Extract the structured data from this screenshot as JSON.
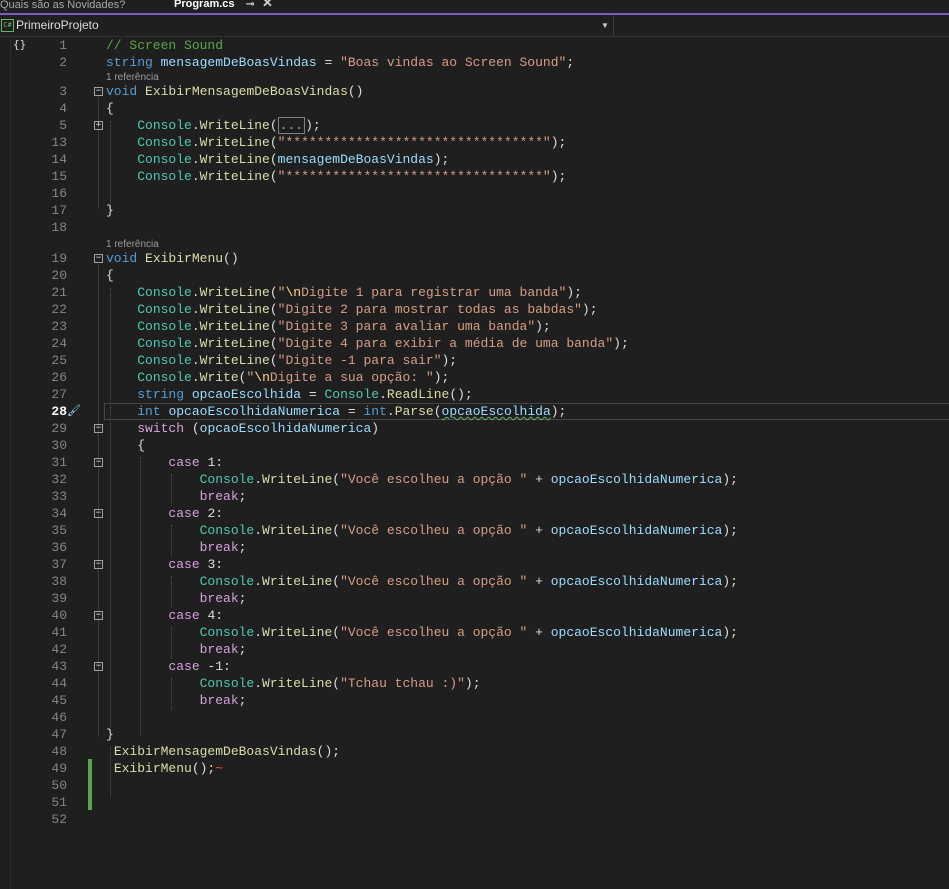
{
  "tabs": {
    "inactive": "Quais são as Novidades?",
    "active": "Program.cs",
    "pin_icon": "pin-icon",
    "close_icon": "close-icon"
  },
  "navbar": {
    "project": "PrimeiroProjeto",
    "project_icon": "csharp-project-icon",
    "dropdown_icon": "chevron-down-icon"
  },
  "editor": {
    "current_line": "28",
    "lens_text": "1 referência",
    "colors": {
      "background": "#1f1f1f",
      "accent": "#7d5bc4",
      "keyword": "#569cd6",
      "control": "#d8a0df",
      "string": "#d69d85",
      "method": "#dcdcaa",
      "class": "#4ec9b0",
      "variable": "#9cdcfe",
      "comment": "#57a64a"
    },
    "lines": [
      {
        "n": "1",
        "text": "// Screen Sound"
      },
      {
        "n": "2",
        "text": "string mensagemDeBoasVindas = \"Boas vindas ao Screen Sound\";"
      },
      {
        "n": "3",
        "text": "void ExibirMensagemDeBoasVindas()"
      },
      {
        "n": "4",
        "text": "{"
      },
      {
        "n": "5",
        "text": "    Console.WriteLine(...);"
      },
      {
        "n": "13",
        "text": "    Console.WriteLine(\"*********************************\");"
      },
      {
        "n": "14",
        "text": "    Console.WriteLine(mensagemDeBoasVindas);"
      },
      {
        "n": "15",
        "text": "    Console.WriteLine(\"*********************************\");"
      },
      {
        "n": "16",
        "text": ""
      },
      {
        "n": "17",
        "text": "}"
      },
      {
        "n": "18",
        "text": ""
      },
      {
        "n": "19",
        "text": "void ExibirMenu()"
      },
      {
        "n": "20",
        "text": "{"
      },
      {
        "n": "21",
        "text": "    Console.WriteLine(\"\\nDigite 1 para registrar uma banda\");"
      },
      {
        "n": "22",
        "text": "    Console.WriteLine(\"Digite 2 para mostrar todas as babdas\");"
      },
      {
        "n": "23",
        "text": "    Console.WriteLine(\"Digite 3 para avaliar uma banda\");"
      },
      {
        "n": "24",
        "text": "    Console.WriteLine(\"Digite 4 para exibir a média de uma banda\");"
      },
      {
        "n": "25",
        "text": "    Console.WriteLine(\"Digite -1 para sair\");"
      },
      {
        "n": "26",
        "text": "    Console.Write(\"\\nDigite a sua opção: \");"
      },
      {
        "n": "27",
        "text": "    string opcaoEscolhida = Console.ReadLine();"
      },
      {
        "n": "28",
        "text": "    int opcaoEscolhidaNumerica = int.Parse(opcaoEscolhida);"
      },
      {
        "n": "29",
        "text": "    switch (opcaoEscolhidaNumerica)"
      },
      {
        "n": "30",
        "text": "    {"
      },
      {
        "n": "31",
        "text": "        case 1:"
      },
      {
        "n": "32",
        "text": "            Console.WriteLine(\"Você escolheu a opção \" + opcaoEscolhidaNumerica);"
      },
      {
        "n": "33",
        "text": "            break;"
      },
      {
        "n": "34",
        "text": "        case 2:"
      },
      {
        "n": "35",
        "text": "            Console.WriteLine(\"Você escolheu a opção \" + opcaoEscolhidaNumerica);"
      },
      {
        "n": "36",
        "text": "            break;"
      },
      {
        "n": "37",
        "text": "        case 3:"
      },
      {
        "n": "38",
        "text": "            Console.WriteLine(\"Você escolheu a opção \" + opcaoEscolhidaNumerica);"
      },
      {
        "n": "39",
        "text": "            break;"
      },
      {
        "n": "40",
        "text": "        case 4:"
      },
      {
        "n": "41",
        "text": "            Console.WriteLine(\"Você escolheu a opção \" + opcaoEscolhidaNumerica);"
      },
      {
        "n": "42",
        "text": "            break;"
      },
      {
        "n": "43",
        "text": "        case -1:"
      },
      {
        "n": "44",
        "text": "            Console.WriteLine(\"Tchau tchau :)\");"
      },
      {
        "n": "45",
        "text": "            break;"
      },
      {
        "n": "46",
        "text": ""
      },
      {
        "n": "47",
        "text": "}"
      },
      {
        "n": "48",
        "text": " ExibirMensagemDeBoasVindas();"
      },
      {
        "n": "49",
        "text": " ExibirMenu();"
      },
      {
        "n": "50",
        "text": ""
      },
      {
        "n": "51",
        "text": ""
      },
      {
        "n": "52",
        "text": ""
      }
    ]
  }
}
